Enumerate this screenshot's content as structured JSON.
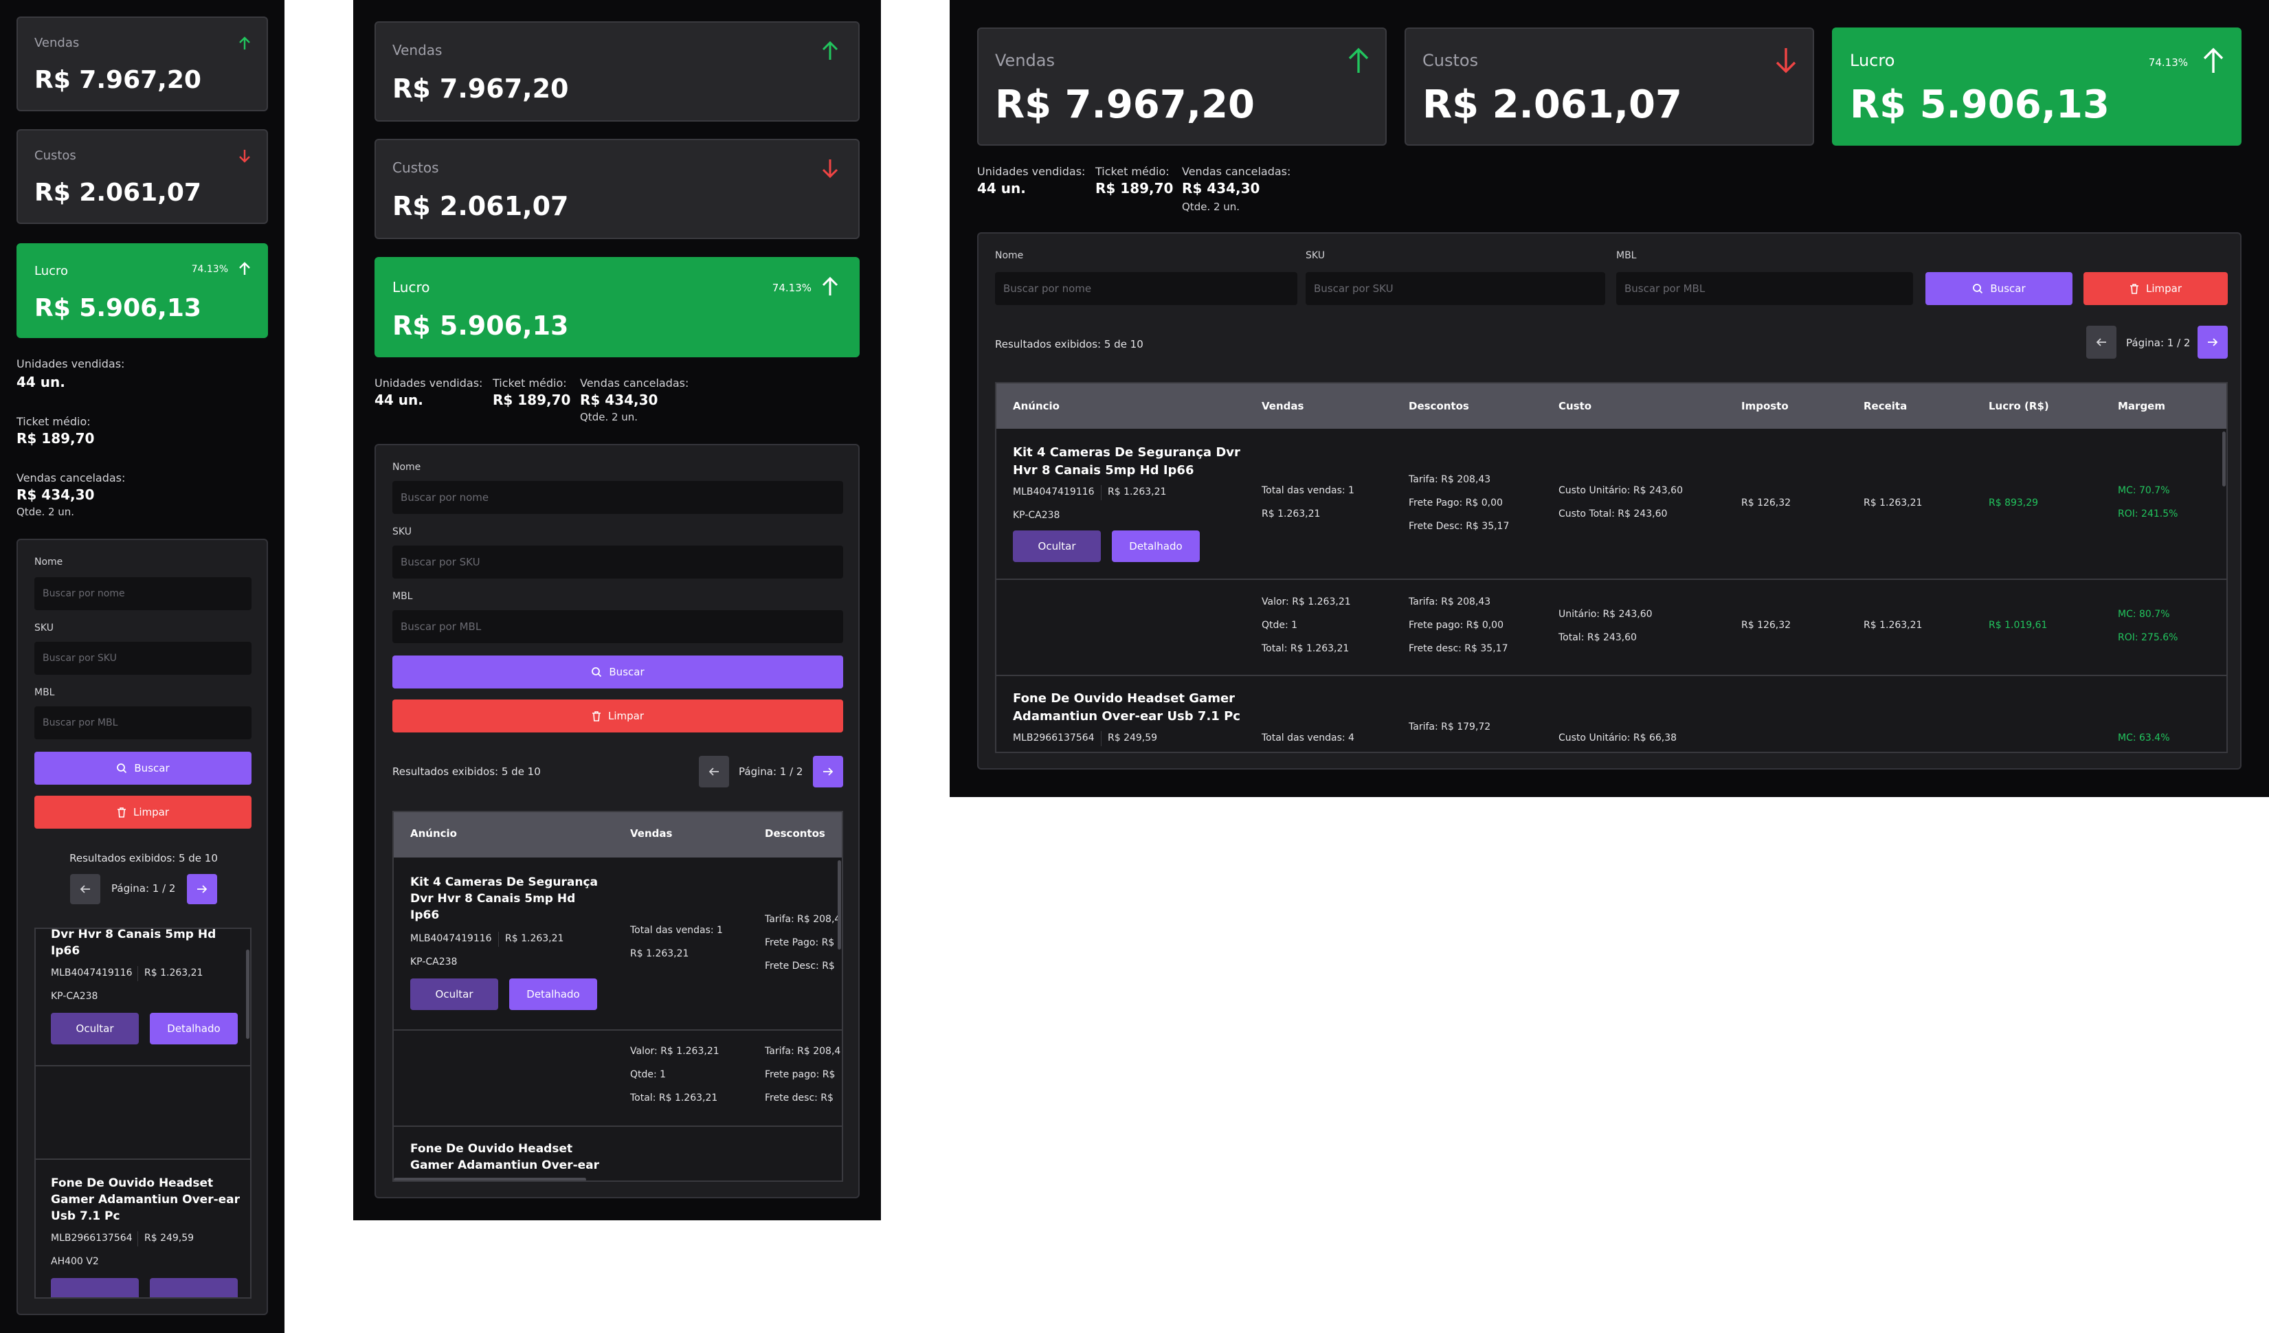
{
  "summary": {
    "sales": {
      "label": "Vendas",
      "value": "R$ 7.967,20"
    },
    "costs": {
      "label": "Custos",
      "value": "R$ 2.061,07"
    },
    "profit": {
      "label": "Lucro",
      "value": "R$ 5.906,13",
      "percent": "74.13%"
    }
  },
  "stats": {
    "units_label": "Unidades vendidas:",
    "units_value": "44 un.",
    "ticket_label": "Ticket médio:",
    "ticket_value": "R$ 189,70",
    "cancel_label": "Vendas canceladas:",
    "cancel_value": "R$ 434,30",
    "cancel_qty": "Qtde. 2 un."
  },
  "filters": {
    "name_label": "Nome",
    "name_placeholder": "Buscar por nome",
    "sku_label": "SKU",
    "sku_placeholder": "Buscar por SKU",
    "mbl_label": "MBL",
    "mbl_placeholder": "Buscar por MBL",
    "search_button": "Buscar",
    "clear_button": "Limpar"
  },
  "results": {
    "count_text": "Resultados exibidos: 5 de 10",
    "page_text": "Página: 1 / 2"
  },
  "table": {
    "headers": [
      "Anúncio",
      "Vendas",
      "Descontos",
      "Custo",
      "Imposto",
      "Receita",
      "Lucro (R$)",
      "Margem"
    ],
    "hide_button": "Ocultar",
    "detail_button": "Detalhado",
    "row1": {
      "name": "Kit 4 Cameras De Segurança Dvr Hvr 8 Canais 5mp Hd Ip66",
      "name_line1": "Kit 4 Cameras De Segurança Dvr",
      "name_line2": "Hvr 8 Canais 5mp Hd Ip66",
      "name_m1": "Kit 4 Cameras De Segurança",
      "name_m2": "Dvr Hvr 8 Canais 5mp Hd",
      "name_m3": "Ip66",
      "name_s1": "Dvr Hvr 8 Canais 5mp Hd",
      "name_s2": "Ip66",
      "mlb": "MLB4047419116",
      "price": "R$ 1.263,21",
      "sku": "KP-CA238",
      "sales_total": "Total das vendas: 1",
      "sales_value": "R$ 1.263,21",
      "tarifa": "Tarifa: R$ 208,43",
      "tarifa_cut": "Tarifa: R$ 208,4",
      "frete_pago": "Frete Pago: R$ 0,00",
      "frete_pago_cut": "Frete Pago: R$",
      "frete_desc": "Frete Desc: R$ 35,17",
      "frete_desc_cut": "Frete Desc: R$",
      "custo_unit": "Custo Unitário: R$ 243,60",
      "custo_total": "Custo Total: R$ 243,60",
      "imposto": "R$ 126,32",
      "receita": "R$ 1.263,21",
      "lucro": "R$ 893,29",
      "mc": "MC: 70.7%",
      "roi": "ROI: 241.5%"
    },
    "detail1": {
      "valor": "Valor: R$ 1.263,21",
      "qtde": "Qtde: 1",
      "total": "Total: R$ 1.263,21",
      "tarifa": "Tarifa: R$ 208,43",
      "tarifa_cut": "Tarifa: R$ 208,4",
      "frete_pago": "Frete pago: R$ 0,00",
      "frete_pago_cut": "Frete pago: R$",
      "frete_desc": "Frete desc: R$ 35,17",
      "frete_desc_cut": "Frete desc: R$",
      "unit": "Unitário: R$ 243,60",
      "total_cost": "Total: R$ 243,60",
      "imposto": "R$ 126,32",
      "receita": "R$ 1.263,21",
      "lucro": "R$ 1.019,61",
      "mc": "MC: 80.7%",
      "roi": "ROI: 275.6%"
    },
    "row2": {
      "name_line1": "Fone De Ouvido Headset Gamer",
      "name_line2": "Adamantiun Over-ear Usb 7.1 Pc",
      "name_m1": "Fone De Ouvido Headset",
      "name_m2": "Gamer Adamantiun Over-ear",
      "name_s1": "Fone De Ouvido Headset",
      "name_s2": "Gamer Adamantiun Over-ear",
      "name_s3": "Usb 7.1 Pc",
      "mlb": "MLB2966137564",
      "price": "R$ 249,59",
      "sku": "AH400 V2",
      "sales_total": "Total das vendas: 4",
      "tarifa": "Tarifa: R$ 179,72",
      "custo_unit": "Custo Unitário: R$ 66,38",
      "mc": "MC: 63.4%"
    }
  },
  "colors": {
    "green": "#16a34a",
    "purple": "#8b5cf6",
    "red": "#ef4444",
    "up_arrow": "#22c55e",
    "down_arrow": "#ef4444"
  },
  "icons": [
    "arrow-up-icon",
    "arrow-down-icon",
    "search-icon",
    "trash-icon",
    "arrow-left-icon",
    "arrow-right-icon"
  ]
}
